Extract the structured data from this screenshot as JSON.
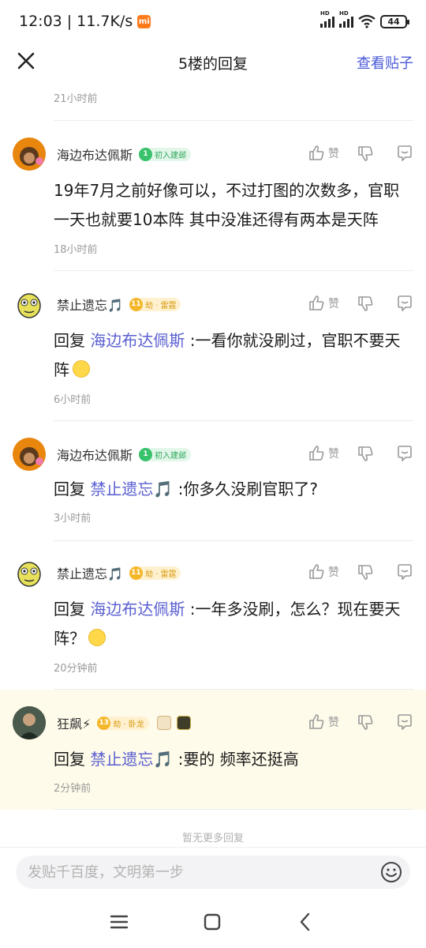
{
  "status": {
    "time": "12:03",
    "separator": "|",
    "speed": "11.7K/s",
    "mi": "mi",
    "hd1": "HD",
    "hd2": "HD",
    "battery": "44"
  },
  "nav": {
    "title": "5楼的回复",
    "link": "查看贴子"
  },
  "first_time": "21小时前",
  "replies": [
    {
      "user": "海边布达佩斯",
      "level": "1",
      "badge": "初入建邺",
      "like": "赞",
      "reply_prefix": "",
      "mention": "",
      "text": "19年7月之前好像可以，不过打图的次数多，官职一天也就要10本阵 其中没准还得有两本是天阵",
      "time": "18小时前"
    },
    {
      "user": "禁止遗忘🎵",
      "level": "11",
      "badge": "劫 · 雷霆",
      "like": "赞",
      "reply_prefix": "回复",
      "mention": "海边布达佩斯",
      "text": " :一看你就没刷过，官职不要天阵",
      "time": "6小时前"
    },
    {
      "user": "海边布达佩斯",
      "level": "1",
      "badge": "初入建邺",
      "like": "赞",
      "reply_prefix": "回复",
      "mention": "禁止遗忘🎵",
      "text": " :你多久没刷官职了?",
      "time": "3小时前"
    },
    {
      "user": "禁止遗忘🎵",
      "level": "11",
      "badge": "劫 · 雷霆",
      "like": "赞",
      "reply_prefix": "回复",
      "mention": "海边布达佩斯",
      "text": " :一年多没刷，怎么？现在要天阵？",
      "time": "20分钟前"
    },
    {
      "user": "狂飙⚡",
      "level": "13",
      "badge": "劫 · 卧龙",
      "like": "赞",
      "reply_prefix": "回复",
      "mention": "禁止遗忘🎵",
      "text": " :要的 频率还挺高",
      "time": "2分钟前"
    }
  ],
  "no_more": "暂无更多回复",
  "input": {
    "placeholder": "发贴千百度，文明第一步"
  },
  "colors": {
    "accent": "#4b5ad8",
    "mention": "#5a5fd0",
    "highlight_bg": "#fffbea"
  }
}
